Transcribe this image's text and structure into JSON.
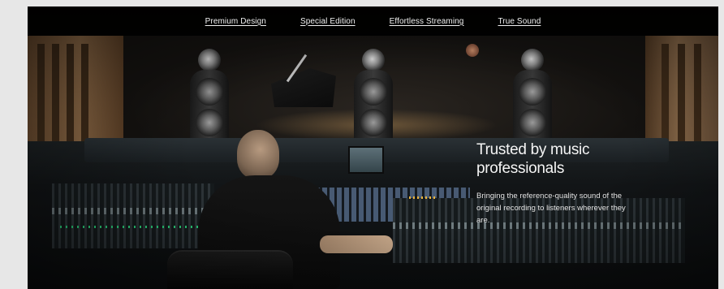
{
  "nav": {
    "items": [
      {
        "label": "Premium Design"
      },
      {
        "label": "Special Edition"
      },
      {
        "label": "Effortless Streaming"
      },
      {
        "label": "True Sound"
      }
    ]
  },
  "hero": {
    "headline": "Trusted by music professionals",
    "body": "Bringing the reference-quality sound of the original recording to listeners wherever they are."
  },
  "colors": {
    "page_background": "#e7e7e7",
    "nav_background": "#000000",
    "text": "#f4f4f4"
  }
}
